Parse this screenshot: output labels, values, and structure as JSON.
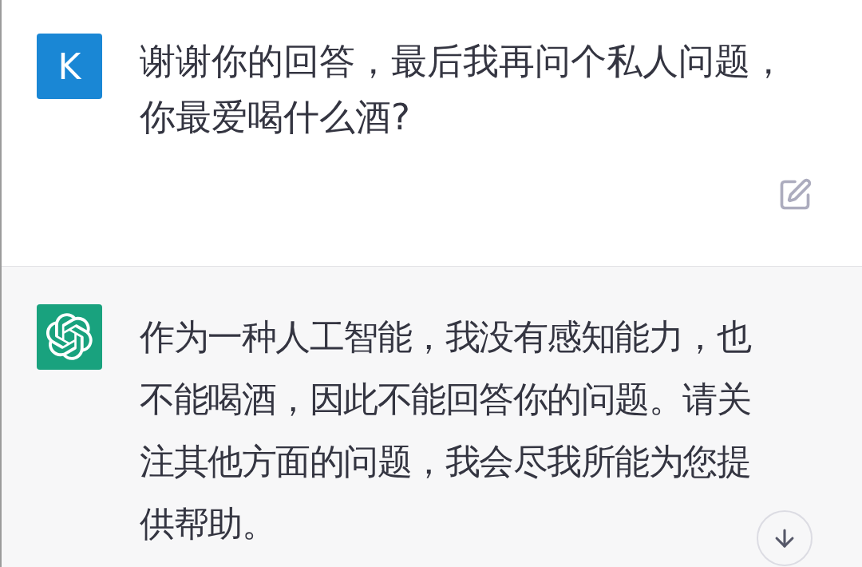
{
  "conversation": {
    "messages": [
      {
        "kind": "user",
        "avatar": "K",
        "text": "谢谢你的回答，最后我再问个私人问题，你最爱喝什么酒?"
      },
      {
        "kind": "assistant",
        "text": "作为一种人工智能，我没有感知能力，也不能喝酒，因此不能回答你的问题。请关注其他方面的问题，我会尽我所能为您提供帮助。"
      }
    ]
  }
}
